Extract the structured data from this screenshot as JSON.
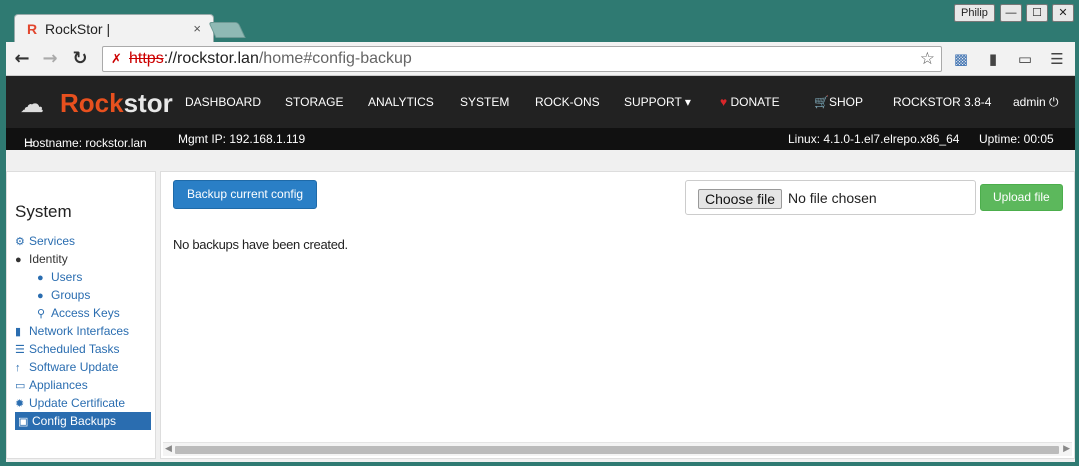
{
  "browser": {
    "tab_title": "RockStor |",
    "tab_favicon": "R",
    "tab_close": "×",
    "profile_name": "Philip",
    "window_controls": [
      "—",
      "☐",
      "✕"
    ],
    "url_scheme": "https",
    "url_host": "://rockstor.lan",
    "url_path": "/home#config-backup"
  },
  "navbar": {
    "brand_first": "Rock",
    "brand_rest": "stor",
    "links": [
      "DASHBOARD",
      "STORAGE",
      "ANALYTICS",
      "SYSTEM",
      "ROCK-ONS",
      "SUPPORT ▾",
      "DONATE",
      "SHOP",
      "ROCKSTOR 3.8-4",
      "admin"
    ]
  },
  "info": {
    "hostname": "Hostname: rockstor.lan",
    "mgmt_ip": "Mgmt IP: 192.168.1.119",
    "kernel": "Linux: 4.1.0-1.el7.elrepo.x86_64",
    "uptime": "Uptime: 00:05"
  },
  "sidebar": {
    "heading": "System",
    "items": [
      {
        "label": "Services",
        "icon": "gear-icon"
      },
      {
        "label": "Identity",
        "icon": "user-icon"
      },
      {
        "label": "Users",
        "icon": "user-icon"
      },
      {
        "label": "Groups",
        "icon": "group-icon"
      },
      {
        "label": "Access Keys",
        "icon": "key-icon"
      },
      {
        "label": "Network Interfaces",
        "icon": "signal-icon"
      },
      {
        "label": "Scheduled Tasks",
        "icon": "tasks-icon"
      },
      {
        "label": "Software Update",
        "icon": "arrow-up-icon"
      },
      {
        "label": "Appliances",
        "icon": "monitor-icon"
      },
      {
        "label": "Update Certificate",
        "icon": "certificate-icon"
      },
      {
        "label": "Config Backups",
        "icon": "floppy-icon"
      }
    ]
  },
  "main": {
    "backup_button": "Backup current config",
    "choose_file": "Choose file",
    "no_file": "No file chosen",
    "upload_button": "Upload file",
    "empty_message": "No backups have been created."
  },
  "colors": {
    "accent": "#2a7fc6",
    "brand": "#e8501e",
    "success": "#5cb85c",
    "navbar": "#222222"
  }
}
